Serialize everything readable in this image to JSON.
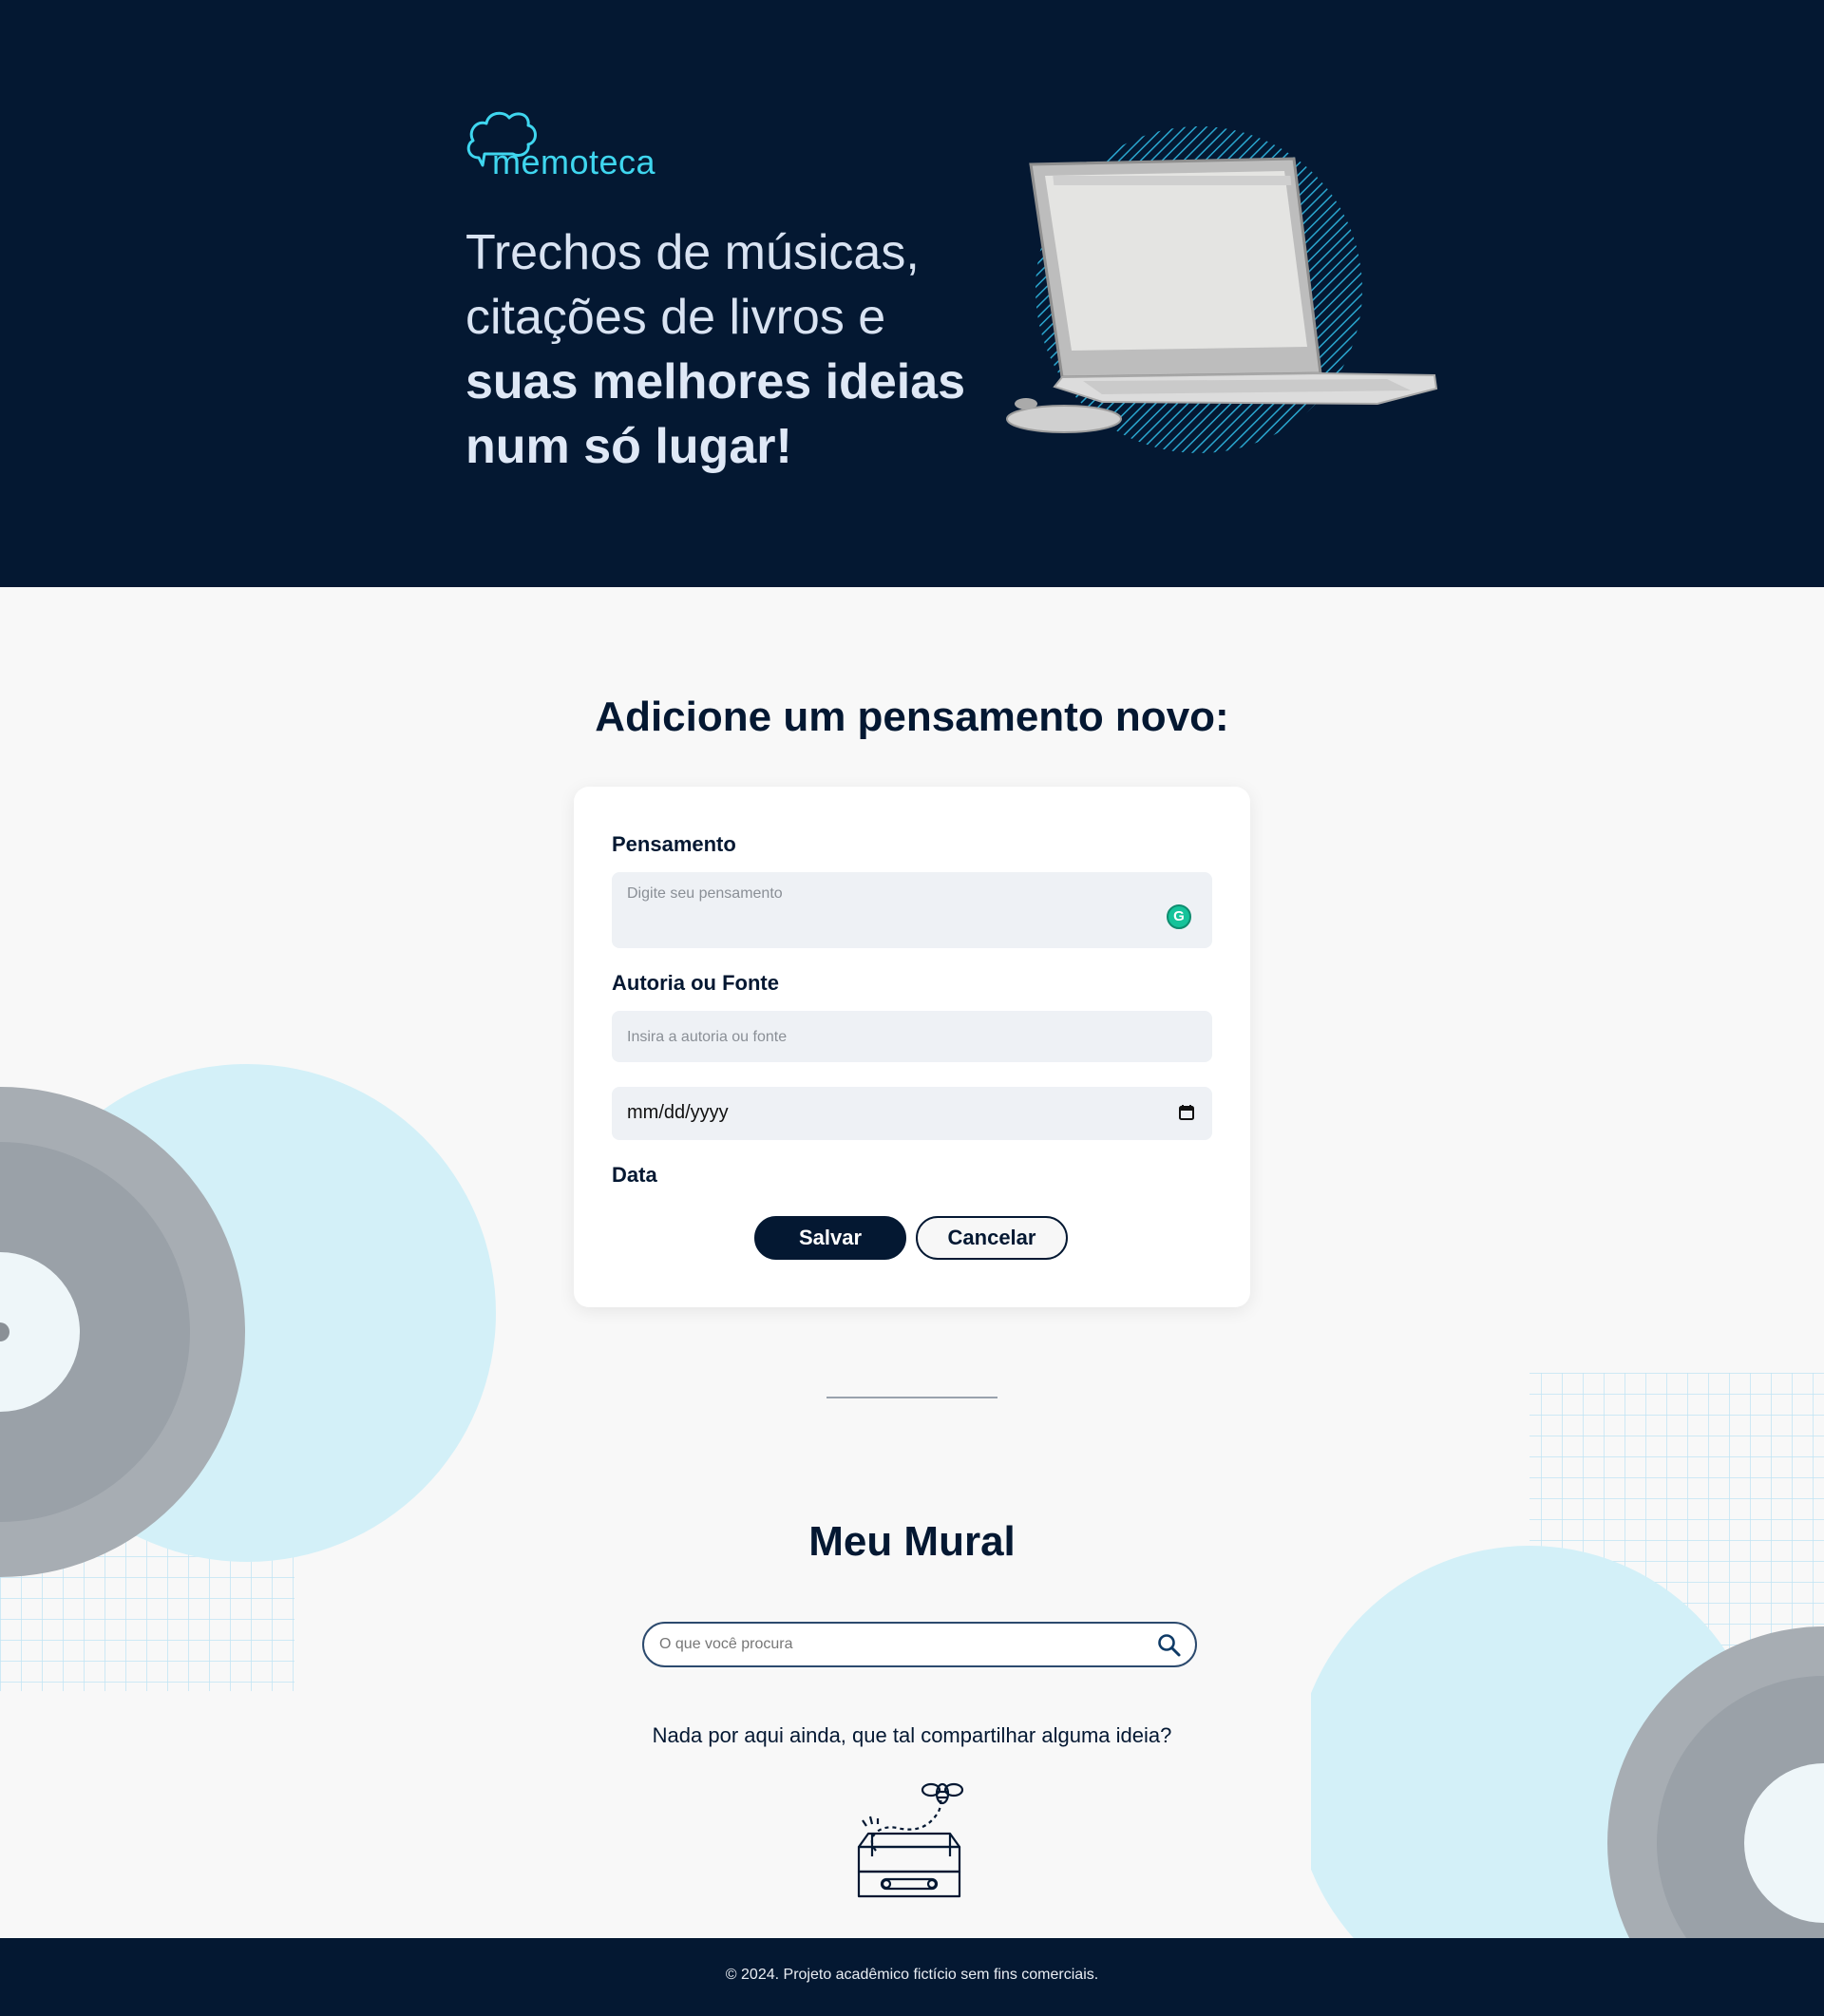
{
  "header": {
    "logo_text": "memoteca",
    "headline_light_1": "Trechos de músicas,",
    "headline_light_2": "citações de livros e",
    "headline_bold_1": "suas melhores ideias",
    "headline_bold_2": "num só lugar!"
  },
  "form": {
    "title": "Adicione um pensamento novo:",
    "thought_label": "Pensamento",
    "thought_placeholder": "Digite seu pensamento",
    "author_label": "Autoria ou Fonte",
    "author_placeholder": "Insira a autoria ou fonte",
    "date_value": "mm/dd/yyyy",
    "date_label": "Data",
    "save_label": "Salvar",
    "cancel_label": "Cancelar"
  },
  "mural": {
    "title": "Meu Mural",
    "search_placeholder": "O que você procura",
    "empty_message": "Nada por aqui ainda, que tal compartilhar alguma ideia?"
  },
  "footer": {
    "text": "© 2024. Projeto acadêmico fictício sem fins comerciais."
  },
  "colors": {
    "navy": "#041832",
    "accent": "#3fd6ef",
    "field_bg": "#eef1f5",
    "page_bg": "#f8f8f8"
  }
}
